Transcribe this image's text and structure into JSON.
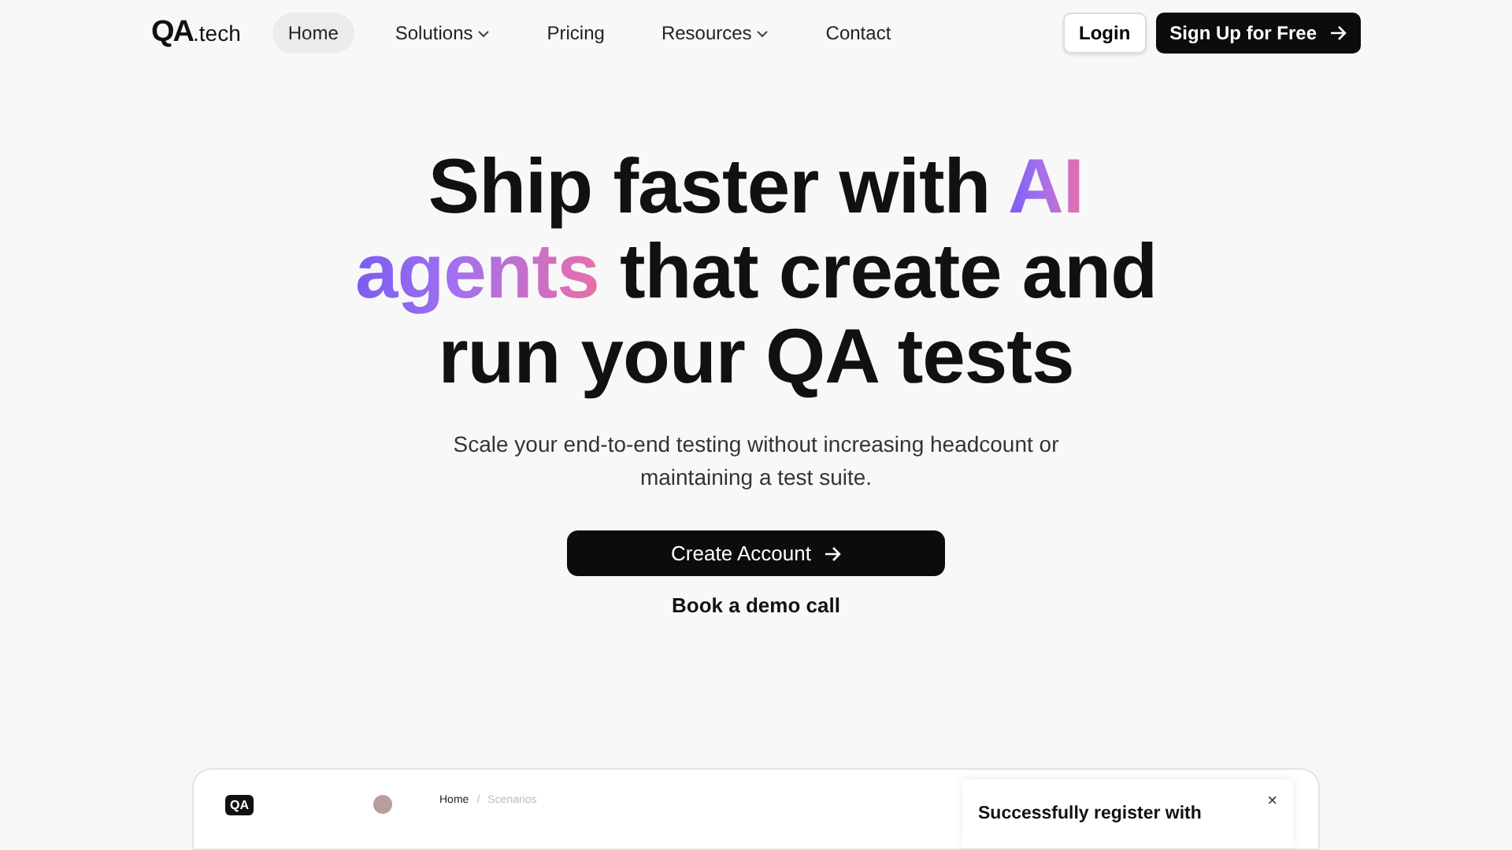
{
  "nav": {
    "logo": {
      "main": "QA",
      "suffix": ".tech"
    },
    "items": [
      {
        "label": "Home",
        "selected": true,
        "dropdown": false
      },
      {
        "label": "Solutions",
        "selected": false,
        "dropdown": true
      },
      {
        "label": "Pricing",
        "selected": false,
        "dropdown": false
      },
      {
        "label": "Resources",
        "selected": false,
        "dropdown": true
      },
      {
        "label": "Contact",
        "selected": false,
        "dropdown": false
      }
    ],
    "login": "Login",
    "signup": "Sign Up for Free"
  },
  "hero": {
    "heading_lines": [
      [
        {
          "text": "Ship faster with ",
          "highlight": false
        },
        {
          "text": "AI",
          "highlight": true
        }
      ],
      [
        {
          "text": "agents",
          "highlight": true
        },
        {
          "text": " that create and",
          "highlight": false
        }
      ],
      [
        {
          "text": "run your QA tests",
          "highlight": false
        }
      ]
    ],
    "subtitle": "Scale your end-to-end testing without increasing headcount or maintaining a test suite.",
    "primary_button": "Create Account",
    "secondary_link": "Book a demo call"
  },
  "preview": {
    "logo": "QA",
    "breadcrumb": [
      "Home",
      "Scenarios"
    ],
    "breadcrumb_separator": "/",
    "toast": {
      "title": "Successfully register with",
      "close": "×"
    }
  }
}
